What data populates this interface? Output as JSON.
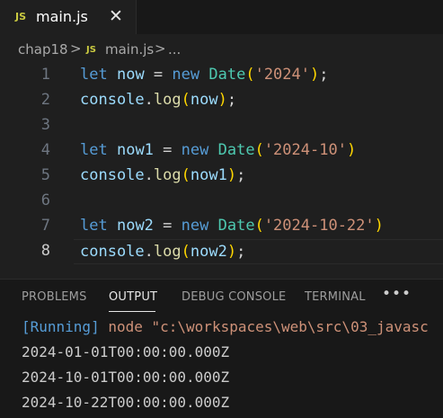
{
  "tab": {
    "badge": "JS",
    "filename": "main.js",
    "close_icon": "close-icon",
    "close_glyph": "✕"
  },
  "breadcrumb": {
    "folder": "chap18",
    "separator": ">",
    "file_badge": "JS",
    "file": "main.js",
    "more": "..."
  },
  "editor": {
    "current_line": 8,
    "lines": [
      {
        "number": "1",
        "text": "let now = new Date('2024');"
      },
      {
        "number": "2",
        "text": "console.log(now);"
      },
      {
        "number": "3",
        "text": ""
      },
      {
        "number": "4",
        "text": "let now1 = new Date('2024-10')"
      },
      {
        "number": "5",
        "text": "console.log(now1);"
      },
      {
        "number": "6",
        "text": ""
      },
      {
        "number": "7",
        "text": "let now2 = new Date('2024-10-22')"
      },
      {
        "number": "8",
        "text": "console.log(now2);"
      }
    ]
  },
  "panel": {
    "tabs": [
      "PROBLEMS",
      "OUTPUT",
      "DEBUG CONSOLE",
      "TERMINAL"
    ],
    "active_tab": "OUTPUT",
    "more_label": "•••",
    "output": {
      "running_tag": "[Running]",
      "command": "node \"c:\\workspaces\\web\\src\\03_javasc",
      "lines": [
        "2024-01-01T00:00:00.000Z",
        "2024-10-01T00:00:00.000Z",
        "2024-10-22T00:00:00.000Z"
      ]
    }
  },
  "colors": {
    "background": "#1f1f1f",
    "keyword": "#569cd6",
    "variable": "#9cdcfe",
    "function": "#dcdcaa",
    "class": "#4ec9b0",
    "string": "#ce9178",
    "bracket": "#ffd700",
    "js_badge": "#cbcb41"
  }
}
